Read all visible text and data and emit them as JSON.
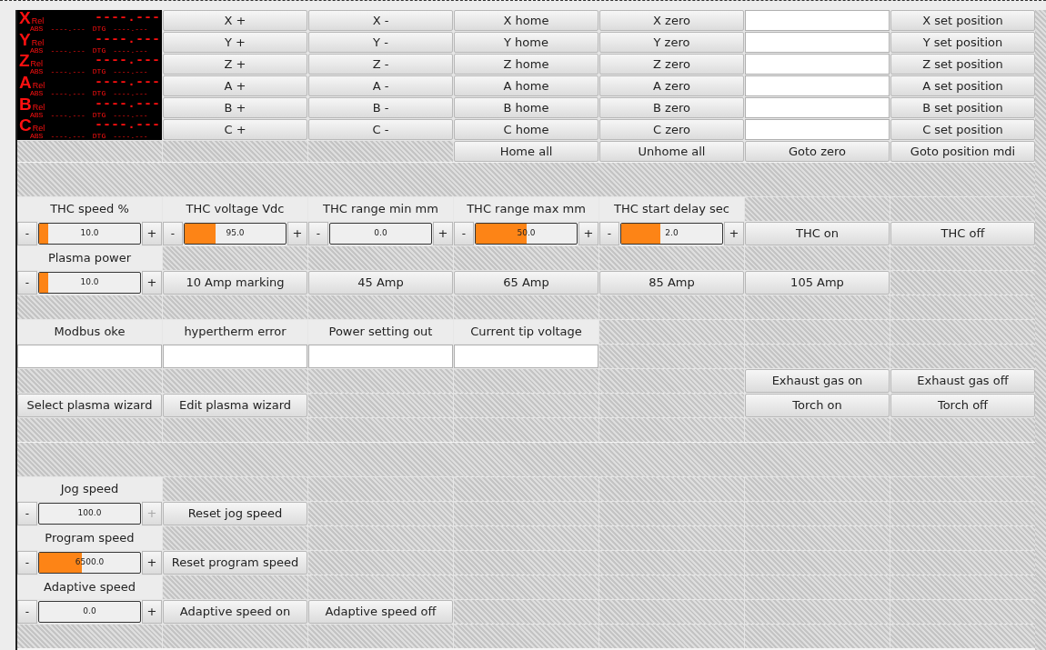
{
  "dro": {
    "axes": [
      {
        "letter": "X",
        "rel": "Rel",
        "value": "----.---",
        "abs": "ABS",
        "abs_value": "----.---",
        "dtg": "DTG",
        "dtg_value": "----.---"
      },
      {
        "letter": "Y",
        "rel": "Rel",
        "value": "----.---",
        "abs": "ABS",
        "abs_value": "----.---",
        "dtg": "DTG",
        "dtg_value": "----.---"
      },
      {
        "letter": "Z",
        "rel": "Rel",
        "value": "----.---",
        "abs": "ABS",
        "abs_value": "----.---",
        "dtg": "DTG",
        "dtg_value": "----.---"
      },
      {
        "letter": "A",
        "rel": "Rel",
        "value": "----.---",
        "abs": "ABS",
        "abs_value": "----.---",
        "dtg": "DTG",
        "dtg_value": "----.---"
      },
      {
        "letter": "B",
        "rel": "Rel",
        "value": "----.---",
        "abs": "ABS",
        "abs_value": "----.---",
        "dtg": "DTG",
        "dtg_value": "----.---"
      },
      {
        "letter": "C",
        "rel": "Rel",
        "value": "----.---",
        "abs": "ABS",
        "abs_value": "----.---",
        "dtg": "DTG",
        "dtg_value": "----.---"
      }
    ]
  },
  "top_rows": [
    {
      "cells": [
        {
          "kind": "button",
          "label": "X +"
        },
        {
          "kind": "button",
          "label": "X -"
        },
        {
          "kind": "button",
          "label": "X home"
        },
        {
          "kind": "button",
          "label": "X zero"
        },
        {
          "kind": "field"
        },
        {
          "kind": "button",
          "label": "X set position"
        }
      ]
    },
    {
      "cells": [
        {
          "kind": "button",
          "label": "Y +"
        },
        {
          "kind": "button",
          "label": "Y -"
        },
        {
          "kind": "button",
          "label": "Y home"
        },
        {
          "kind": "button",
          "label": "Y zero"
        },
        {
          "kind": "field"
        },
        {
          "kind": "button",
          "label": "Y set position"
        }
      ]
    },
    {
      "cells": [
        {
          "kind": "button",
          "label": "Z +"
        },
        {
          "kind": "button",
          "label": "Z -"
        },
        {
          "kind": "button",
          "label": "Z home"
        },
        {
          "kind": "button",
          "label": "Z zero"
        },
        {
          "kind": "field"
        },
        {
          "kind": "button",
          "label": "Z set position"
        }
      ]
    },
    {
      "cells": [
        {
          "kind": "button",
          "label": "A +"
        },
        {
          "kind": "button",
          "label": "A -"
        },
        {
          "kind": "button",
          "label": "A home"
        },
        {
          "kind": "button",
          "label": "A zero"
        },
        {
          "kind": "field"
        },
        {
          "kind": "button",
          "label": "A set position"
        }
      ]
    },
    {
      "cells": [
        {
          "kind": "button",
          "label": "B +"
        },
        {
          "kind": "button",
          "label": "B -"
        },
        {
          "kind": "button",
          "label": "B home"
        },
        {
          "kind": "button",
          "label": "B zero"
        },
        {
          "kind": "field"
        },
        {
          "kind": "button",
          "label": "B set position"
        }
      ]
    },
    {
      "cells": [
        {
          "kind": "button",
          "label": "C +"
        },
        {
          "kind": "button",
          "label": "C -"
        },
        {
          "kind": "button",
          "label": "C home"
        },
        {
          "kind": "button",
          "label": "C zero"
        },
        {
          "kind": "field"
        },
        {
          "kind": "button",
          "label": "C set position"
        }
      ]
    },
    {
      "cells": [
        {
          "kind": "empty"
        },
        {
          "kind": "empty"
        },
        {
          "kind": "empty"
        },
        {
          "kind": "button",
          "label": "Home all"
        },
        {
          "kind": "button",
          "label": "Unhome all"
        },
        {
          "kind": "button",
          "label": "Goto zero"
        },
        {
          "kind": "button",
          "label": "Goto position mdi"
        }
      ]
    }
  ],
  "sections": [
    {
      "rows": [
        {
          "cells": [
            {
              "kind": "label",
              "text": "THC speed %"
            },
            {
              "kind": "label",
              "text": "THC voltage Vdc"
            },
            {
              "kind": "label",
              "text": "THC range min mm"
            },
            {
              "kind": "label",
              "text": "THC range max mm"
            },
            {
              "kind": "label",
              "text": "THC start delay sec"
            },
            {
              "kind": "empty"
            },
            {
              "kind": "empty"
            }
          ]
        },
        {
          "cells": [
            {
              "kind": "spin",
              "minus": "-",
              "plus": "+",
              "value": "10.0",
              "level": 0.09,
              "plus_disabled": false
            },
            {
              "kind": "spin",
              "minus": "-",
              "plus": "+",
              "value": "95.0",
              "level": 0.31,
              "plus_disabled": false
            },
            {
              "kind": "spin",
              "minus": "-",
              "plus": "+",
              "value": "0.0",
              "level": 0,
              "plus_disabled": false
            },
            {
              "kind": "spin",
              "minus": "-",
              "plus": "+",
              "value": "50.0",
              "level": 0.5,
              "plus_disabled": false
            },
            {
              "kind": "spin",
              "minus": "-",
              "plus": "+",
              "value": "2.0",
              "level": 0.39,
              "plus_disabled": false
            },
            {
              "kind": "button",
              "label": "THC on"
            },
            {
              "kind": "button",
              "label": "THC off"
            }
          ]
        },
        {
          "cells": [
            {
              "kind": "label",
              "text": "Plasma power"
            },
            {
              "kind": "empty"
            },
            {
              "kind": "empty"
            },
            {
              "kind": "empty"
            },
            {
              "kind": "empty"
            },
            {
              "kind": "empty"
            },
            {
              "kind": "empty"
            }
          ]
        },
        {
          "cells": [
            {
              "kind": "spin",
              "minus": "-",
              "plus": "+",
              "value": "10.0",
              "level": 0.09,
              "plus_disabled": false
            },
            {
              "kind": "button",
              "label": "10 Amp marking"
            },
            {
              "kind": "button",
              "label": "45 Amp"
            },
            {
              "kind": "button",
              "label": "65 Amp"
            },
            {
              "kind": "button",
              "label": "85 Amp"
            },
            {
              "kind": "button",
              "label": "105 Amp"
            },
            {
              "kind": "empty"
            }
          ]
        },
        {
          "cells": [
            {
              "kind": "empty"
            },
            {
              "kind": "empty"
            },
            {
              "kind": "empty"
            },
            {
              "kind": "empty"
            },
            {
              "kind": "empty"
            },
            {
              "kind": "empty"
            },
            {
              "kind": "empty"
            }
          ]
        },
        {
          "cells": [
            {
              "kind": "label",
              "text": "Modbus oke"
            },
            {
              "kind": "label",
              "text": "hypertherm error"
            },
            {
              "kind": "label",
              "text": "Power setting out"
            },
            {
              "kind": "label",
              "text": "Current tip voltage"
            },
            {
              "kind": "empty"
            },
            {
              "kind": "empty"
            },
            {
              "kind": "empty"
            }
          ]
        },
        {
          "cells": [
            {
              "kind": "field"
            },
            {
              "kind": "field"
            },
            {
              "kind": "field"
            },
            {
              "kind": "field"
            },
            {
              "kind": "empty"
            },
            {
              "kind": "empty"
            },
            {
              "kind": "empty"
            }
          ]
        },
        {
          "cells": [
            {
              "kind": "empty"
            },
            {
              "kind": "empty"
            },
            {
              "kind": "empty"
            },
            {
              "kind": "empty"
            },
            {
              "kind": "empty"
            },
            {
              "kind": "button",
              "label": "Exhaust gas on"
            },
            {
              "kind": "button",
              "label": "Exhaust gas off"
            }
          ]
        },
        {
          "cells": [
            {
              "kind": "button",
              "label": "Select plasma wizard"
            },
            {
              "kind": "button",
              "label": "Edit plasma wizard"
            },
            {
              "kind": "empty"
            },
            {
              "kind": "empty"
            },
            {
              "kind": "empty"
            },
            {
              "kind": "button",
              "label": "Torch on"
            },
            {
              "kind": "button",
              "label": "Torch off"
            }
          ]
        },
        {
          "cells": [
            {
              "kind": "empty"
            },
            {
              "kind": "empty"
            },
            {
              "kind": "empty"
            },
            {
              "kind": "empty"
            },
            {
              "kind": "empty"
            },
            {
              "kind": "empty"
            },
            {
              "kind": "empty"
            }
          ]
        }
      ]
    },
    {
      "rows": [
        {
          "cells": [
            {
              "kind": "label",
              "text": "Jog speed"
            },
            {
              "kind": "empty"
            },
            {
              "kind": "empty"
            },
            {
              "kind": "empty"
            },
            {
              "kind": "empty"
            },
            {
              "kind": "empty"
            },
            {
              "kind": "empty"
            }
          ]
        },
        {
          "cells": [
            {
              "kind": "spin",
              "minus": "-",
              "plus": "+",
              "value": "100.0",
              "level": 0,
              "plus_disabled": true
            },
            {
              "kind": "button",
              "label": "Reset jog speed"
            },
            {
              "kind": "empty"
            },
            {
              "kind": "empty"
            },
            {
              "kind": "empty"
            },
            {
              "kind": "empty"
            },
            {
              "kind": "empty"
            }
          ]
        },
        {
          "cells": [
            {
              "kind": "label",
              "text": "Program speed"
            },
            {
              "kind": "empty"
            },
            {
              "kind": "empty"
            },
            {
              "kind": "empty"
            },
            {
              "kind": "empty"
            },
            {
              "kind": "empty"
            },
            {
              "kind": "empty"
            }
          ]
        },
        {
          "cells": [
            {
              "kind": "spin",
              "minus": "-",
              "plus": "+",
              "value": "6500.0",
              "level": 0.42,
              "plus_disabled": false
            },
            {
              "kind": "button",
              "label": "Reset program speed"
            },
            {
              "kind": "empty"
            },
            {
              "kind": "empty"
            },
            {
              "kind": "empty"
            },
            {
              "kind": "empty"
            },
            {
              "kind": "empty"
            }
          ]
        },
        {
          "cells": [
            {
              "kind": "label",
              "text": "Adaptive speed"
            },
            {
              "kind": "empty"
            },
            {
              "kind": "empty"
            },
            {
              "kind": "empty"
            },
            {
              "kind": "empty"
            },
            {
              "kind": "empty"
            },
            {
              "kind": "empty"
            }
          ]
        },
        {
          "cells": [
            {
              "kind": "spin",
              "minus": "-",
              "plus": "+",
              "value": "0.0",
              "level": 0,
              "plus_disabled": false
            },
            {
              "kind": "button",
              "label": "Adaptive speed on"
            },
            {
              "kind": "button",
              "label": "Adaptive speed off"
            },
            {
              "kind": "empty"
            },
            {
              "kind": "empty"
            },
            {
              "kind": "empty"
            },
            {
              "kind": "empty"
            }
          ]
        },
        {
          "cells": [
            {
              "kind": "empty"
            },
            {
              "kind": "empty"
            },
            {
              "kind": "empty"
            },
            {
              "kind": "empty"
            },
            {
              "kind": "empty"
            },
            {
              "kind": "empty"
            },
            {
              "kind": "empty"
            }
          ]
        }
      ]
    }
  ]
}
